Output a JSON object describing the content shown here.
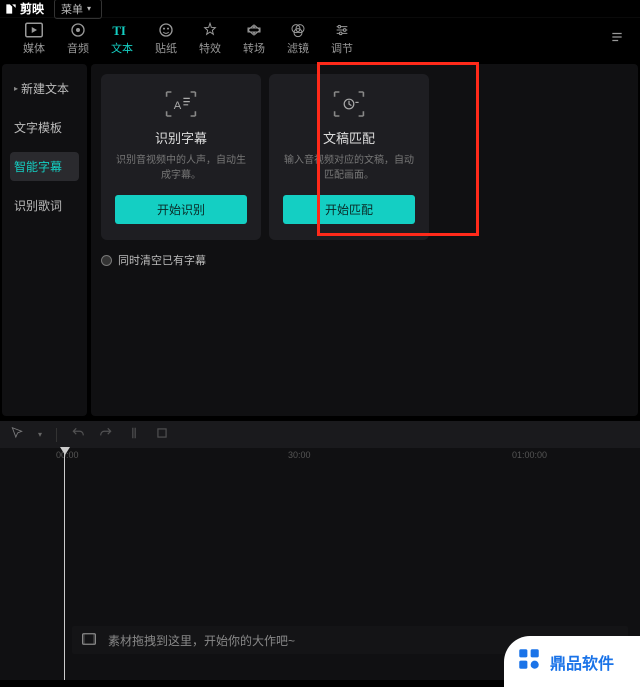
{
  "app": {
    "name": "剪映"
  },
  "menu": {
    "label": "菜单"
  },
  "toolbar": {
    "items": [
      {
        "id": "media",
        "label": "媒体"
      },
      {
        "id": "audio",
        "label": "音频"
      },
      {
        "id": "text",
        "label": "文本",
        "active": true
      },
      {
        "id": "sticker",
        "label": "贴纸"
      },
      {
        "id": "effect",
        "label": "特效"
      },
      {
        "id": "trans",
        "label": "转场"
      },
      {
        "id": "filter",
        "label": "滤镜"
      },
      {
        "id": "adjust",
        "label": "调节"
      }
    ]
  },
  "sidebar": {
    "items": [
      {
        "label": "新建文本",
        "expandable": true
      },
      {
        "label": "文字模板"
      },
      {
        "label": "智能字幕",
        "active": true
      },
      {
        "label": "识别歌词"
      }
    ]
  },
  "cards": {
    "recognize": {
      "title": "识别字幕",
      "desc": "识别音视频中的人声，自动生成字幕。",
      "button": "开始识别"
    },
    "match": {
      "title": "文稿匹配",
      "desc": "输入音视频对应的文稿，自动匹配画面。",
      "button": "开始匹配"
    }
  },
  "clear_existing": {
    "label": "同时清空已有字幕"
  },
  "timeline": {
    "ticks": [
      "00:00",
      "30:00",
      "01:00:00"
    ],
    "placeholder": "素材拖拽到这里，开始你的大作吧~"
  },
  "watermark": {
    "text": "鼎品软件"
  }
}
